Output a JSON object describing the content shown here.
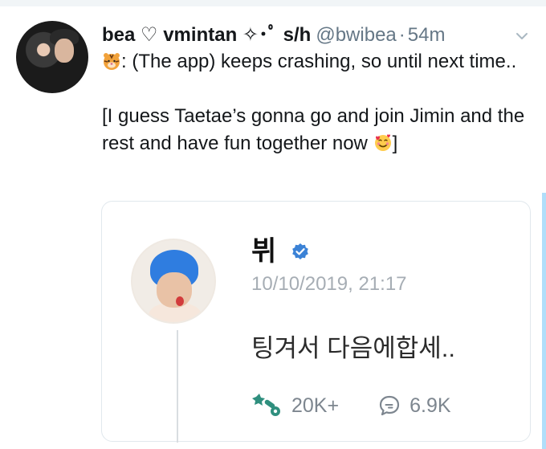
{
  "tweet": {
    "display_name": "bea ♡ vmintan ✧･ﾟ s/h",
    "handle": "@bwibea",
    "separator": "·",
    "time": "54m",
    "text_line1_rest": ": (The app) keeps crashing, so until next time..",
    "text_line2": "[I guess Taetae’s gonna go and join Jimin and the rest and have fun together now",
    "text_line2_end": "]"
  },
  "card": {
    "name": "뷔",
    "date": "10/10/2019, 21:17",
    "text": "팅겨서 다음에합세..",
    "likes": "20K+",
    "comments": "6.9K"
  },
  "colors": {
    "muted": "#657786",
    "verified": "#3b82d6",
    "border": "#e1e8ed",
    "accent_icon": "#2f8f7e"
  },
  "icons": [
    "tiger-emoji",
    "smiling-hearts-emoji",
    "chevron-down-icon",
    "verified-badge-icon",
    "like-wand-icon",
    "comment-icon"
  ]
}
